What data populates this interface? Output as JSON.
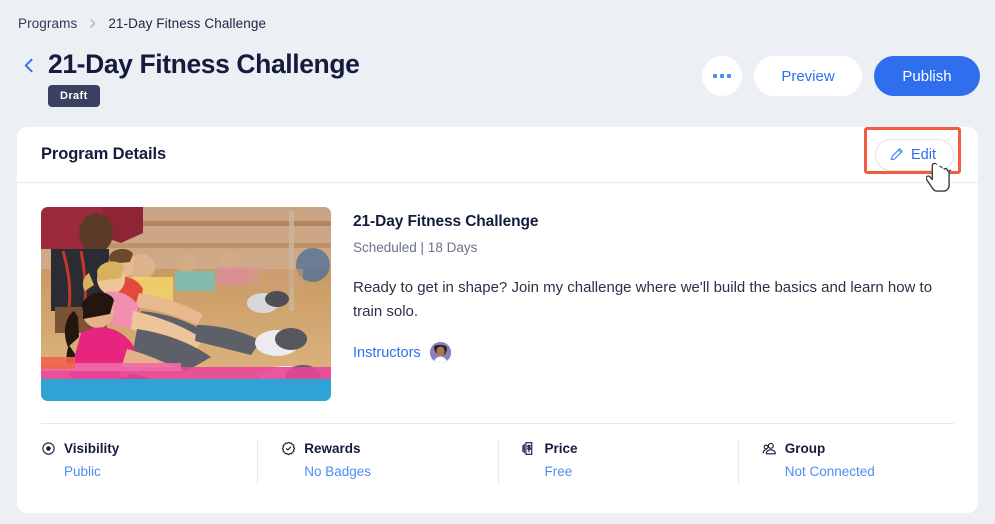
{
  "breadcrumb": {
    "parent": "Programs",
    "separator_icon": "chevron-right-icon",
    "current": "21-Day Fitness Challenge"
  },
  "header": {
    "back_icon": "chevron-left-icon",
    "title": "21-Day Fitness Challenge",
    "status_badge": "Draft",
    "more_icon": "ellipsis-icon",
    "preview_label": "Preview",
    "publish_label": "Publish"
  },
  "card": {
    "title": "Program Details",
    "edit_label": "Edit",
    "edit_icon": "pencil-icon",
    "highlight_color": "#f15d42",
    "cursor_icon": "pointing-hand-cursor"
  },
  "program": {
    "image_alt": "group-fitness-class-photo",
    "name": "21-Day Fitness Challenge",
    "meta_line": "Scheduled | 18 Days",
    "description": "Ready to get in shape? Join my challenge where we'll build the basics and learn how to train solo.",
    "instructors_label": "Instructors",
    "instructor_avatar": "instructor-avatar"
  },
  "meta": [
    {
      "icon": "visibility-eye-icon",
      "label": "Visibility",
      "value": "Public"
    },
    {
      "icon": "rewards-badge-icon",
      "label": "Rewards",
      "value": "No Badges"
    },
    {
      "icon": "price-tag-icon",
      "label": "Price",
      "value": "Free"
    },
    {
      "icon": "group-people-icon",
      "label": "Group",
      "value": "Not Connected"
    }
  ],
  "colors": {
    "accent_blue": "#2f6fed",
    "link_blue": "#4d8cf5",
    "page_bg": "#eceff4",
    "badge_bg": "#3a4160",
    "highlight": "#f15d42"
  }
}
